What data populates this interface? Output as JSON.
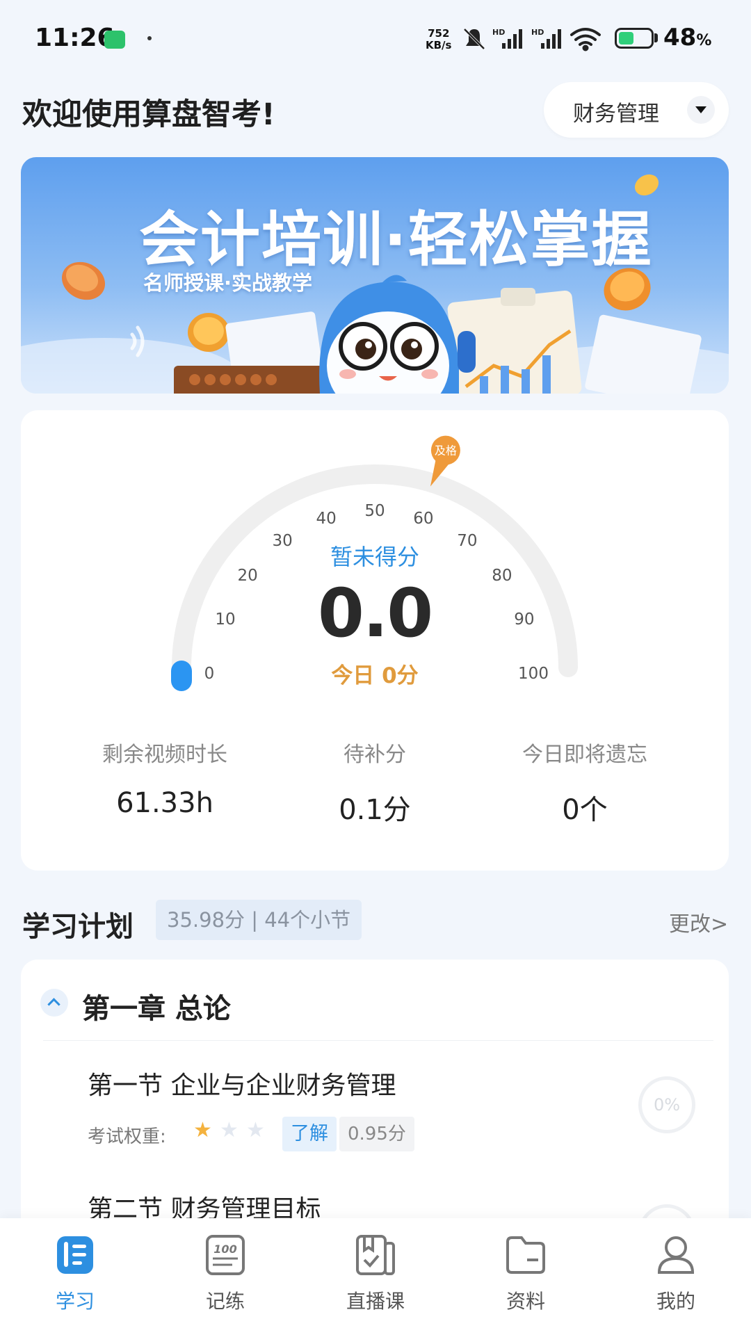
{
  "status_bar": {
    "time": "11:26",
    "net_speed_value": "752",
    "net_speed_unit": "KB/s",
    "battery_percent": 48,
    "battery_label": "48",
    "battery_unit": "%"
  },
  "header": {
    "welcome": "欢迎使用算盘智考!",
    "subject": "财务管理"
  },
  "banner": {
    "title": "会计培训·轻松掌握",
    "subtitle": "名师授课·实战教学"
  },
  "score": {
    "ticks": [
      "0",
      "10",
      "20",
      "30",
      "40",
      "50",
      "60",
      "70",
      "80",
      "90",
      "100"
    ],
    "pass_label": "及格",
    "pass_value": 60,
    "current_value": 0,
    "status": "暂未得分",
    "value": "0.0",
    "today": "今日 0分"
  },
  "stats": [
    {
      "label": "剩余视频时长",
      "value": "61.33h"
    },
    {
      "label": "待补分",
      "value": "0.1分"
    },
    {
      "label": "今日即将遗忘",
      "value": "0个"
    }
  ],
  "plan": {
    "title": "学习计划",
    "summary": "35.98分 | 44个小节",
    "change": "更改>",
    "chapter": "第一章 总论",
    "weight_label": "考试权重:",
    "sections": [
      {
        "title": "第一节  企业与企业财务管理",
        "stars": 1,
        "level": "了解",
        "score": "0.95分",
        "progress": "0%"
      },
      {
        "title": "第二节  财务管理目标"
      }
    ]
  },
  "nav": [
    {
      "label": "学习",
      "icon": "study-icon",
      "active": true
    },
    {
      "label": "记练",
      "icon": "practice-icon",
      "active": false
    },
    {
      "label": "直播课",
      "icon": "live-class-icon",
      "active": false
    },
    {
      "label": "资料",
      "icon": "materials-icon",
      "active": false
    },
    {
      "label": "我的",
      "icon": "profile-icon",
      "active": false
    }
  ],
  "colors": {
    "accent": "#2d8fe0",
    "orange": "#e09b3d",
    "background": "#f2f6fc"
  }
}
